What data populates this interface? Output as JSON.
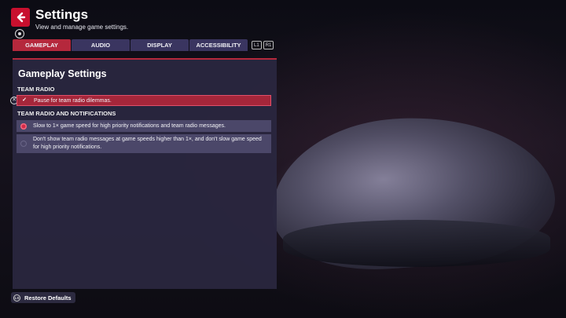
{
  "header": {
    "title": "Settings",
    "subtitle": "View and manage game settings."
  },
  "tabs": [
    {
      "label": "GAMEPLAY",
      "active": true
    },
    {
      "label": "AUDIO",
      "active": false
    },
    {
      "label": "DISPLAY",
      "active": false
    },
    {
      "label": "ACCESSIBILITY",
      "active": false
    }
  ],
  "bumpers": {
    "left": "L1",
    "right": "R1"
  },
  "panel": {
    "title": "Gameplay Settings",
    "sections": [
      {
        "heading": "TEAM RADIO",
        "options": [
          {
            "label": "Pause for team radio dilemmas.",
            "checked": true
          }
        ]
      },
      {
        "heading": "TEAM RADIO AND NOTIFICATIONS",
        "options": [
          {
            "label": "Slow to 1× game speed for high priority notifications and team radio messages.",
            "selected": true
          },
          {
            "label": "Don't show team radio messages at game speeds higher than 1×, and don't slow game speed for high priority notifications.",
            "selected": false
          }
        ]
      }
    ]
  },
  "footer": {
    "restore_label": "Restore Defaults",
    "restore_button_hint": "LS"
  },
  "colors": {
    "accent": "#b5283c",
    "panel": "#2a273e",
    "tab": "#3a3560"
  },
  "icons": {
    "back": "back-arrow-icon",
    "secondary": "circle-button-icon",
    "deselect": "x-button-icon",
    "check": "check-icon"
  }
}
